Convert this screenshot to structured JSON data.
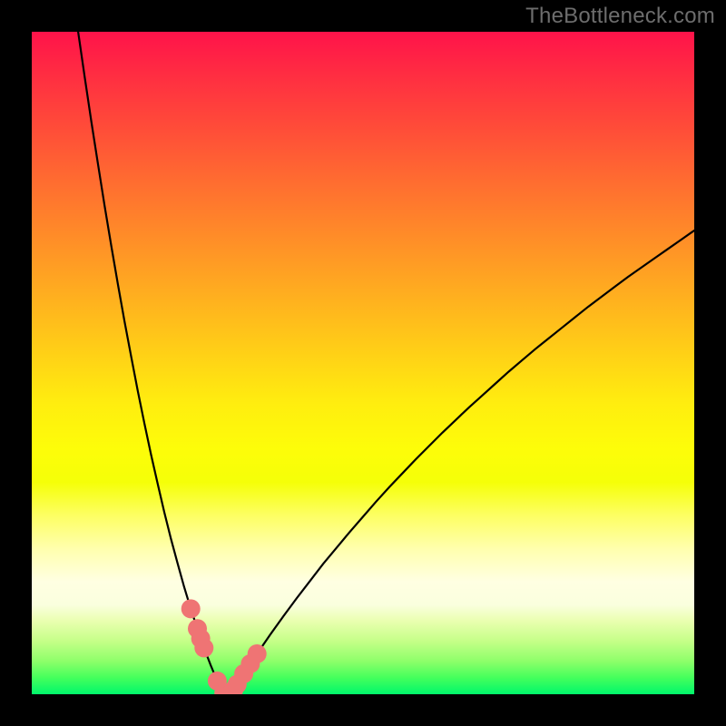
{
  "watermark": "TheBottleneck.com",
  "colors": {
    "frame": "#000000",
    "curve": "#000000",
    "marker": "#ef7474",
    "gradient_top": "#ff134a",
    "gradient_bottom": "#00f76b"
  },
  "chart_data": {
    "type": "line",
    "title": "",
    "xlabel": "",
    "ylabel": "",
    "xlim": [
      0,
      100
    ],
    "ylim": [
      0,
      100
    ],
    "x": [
      7,
      8,
      9,
      10,
      11,
      12,
      13,
      14,
      15,
      16,
      17,
      18,
      19,
      20,
      21,
      22,
      23,
      24,
      25,
      26,
      27,
      28,
      29,
      30,
      31,
      32,
      33,
      34,
      36,
      38,
      40,
      42,
      44,
      46,
      48,
      50,
      52,
      54,
      56,
      58,
      60,
      62,
      64,
      66,
      68,
      70,
      72,
      74,
      76,
      78,
      80,
      82,
      84,
      86,
      88,
      90,
      92,
      94,
      96,
      98,
      100
    ],
    "values": [
      100.0,
      93.1,
      86.4,
      80.0,
      73.7,
      67.7,
      61.9,
      56.3,
      51.0,
      45.8,
      40.9,
      36.2,
      31.8,
      27.5,
      23.5,
      19.8,
      16.2,
      12.9,
      9.9,
      7.0,
      4.4,
      2.0,
      0.2,
      0.0,
      1.5,
      3.1,
      4.6,
      6.1,
      9.0,
      11.8,
      14.5,
      17.1,
      19.7,
      22.1,
      24.5,
      26.8,
      29.1,
      31.3,
      33.4,
      35.5,
      37.5,
      39.5,
      41.4,
      43.3,
      45.1,
      46.9,
      48.7,
      50.4,
      52.1,
      53.7,
      55.3,
      56.9,
      58.5,
      60.0,
      61.5,
      63.0,
      64.4,
      65.8,
      67.2,
      68.6,
      70.0
    ],
    "markers": {
      "x": [
        24.0,
        25.0,
        25.5,
        26.0,
        28.0,
        29.0,
        30.0,
        30.5,
        31.0,
        32.0,
        33.0,
        34.0
      ],
      "y": [
        12.9,
        9.9,
        8.4,
        7.0,
        2.0,
        0.2,
        0.0,
        0.7,
        1.5,
        3.1,
        4.6,
        6.1
      ]
    }
  }
}
